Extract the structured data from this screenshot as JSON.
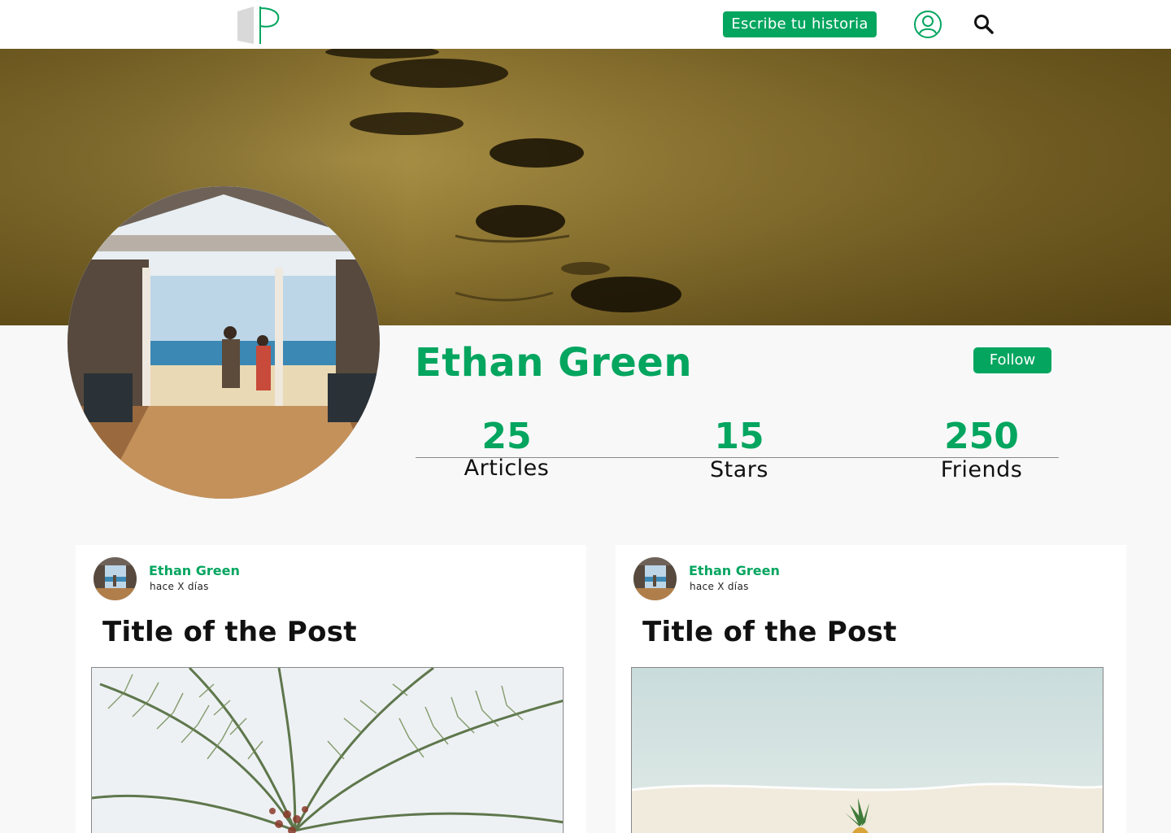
{
  "header": {
    "logo_icon": "p-book-logo",
    "write_button_label": "Escribe tu historia",
    "user_icon": "user-icon",
    "search_icon": "search-icon",
    "accent_color": "#03a55f"
  },
  "banner": {
    "image": "footprints-in-sand"
  },
  "profile": {
    "photo": "beach-cafe-photo",
    "name": "Ethan Green",
    "follow_label": "Follow",
    "stats": [
      {
        "value": "25",
        "label": "Articles"
      },
      {
        "value": "15",
        "label": "Stars"
      },
      {
        "value": "250",
        "label": "Friends"
      }
    ]
  },
  "posts": [
    {
      "author": "Ethan Green",
      "time": "hace X días",
      "title": "Title of the Post",
      "image": "palm-tree-photo"
    },
    {
      "author": "Ethan Green",
      "time": "hace X días",
      "title": "Title of the Post",
      "image": "pineapple-beach-photo"
    }
  ]
}
